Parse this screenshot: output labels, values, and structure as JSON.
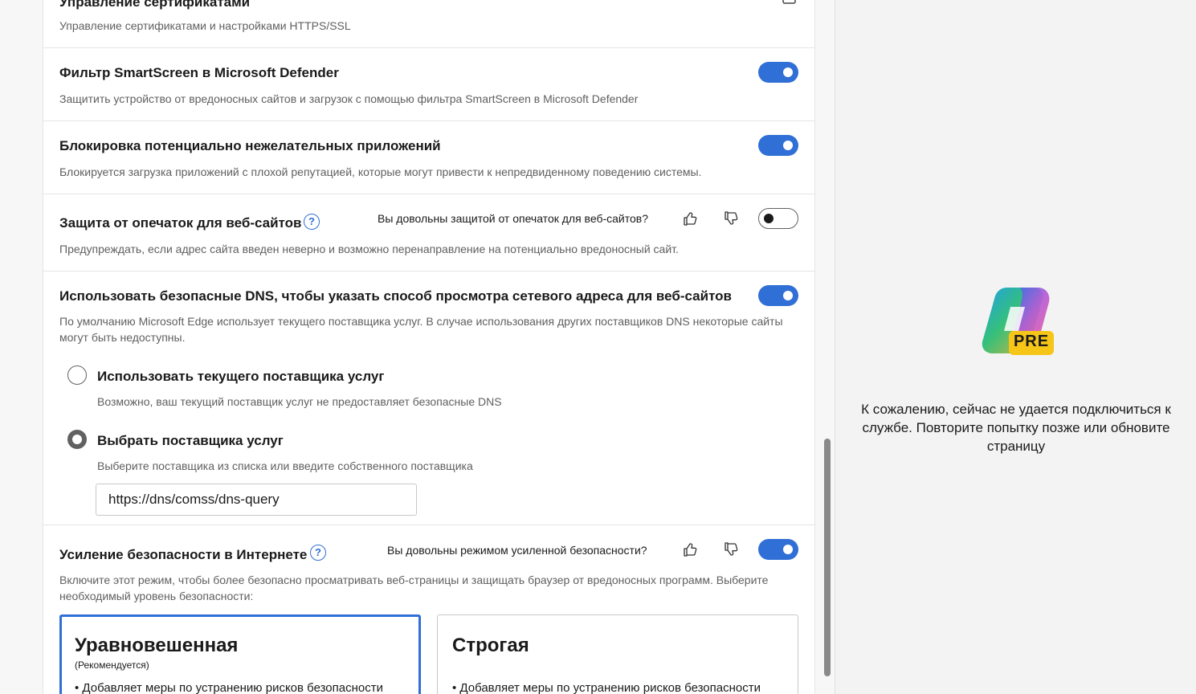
{
  "settings": {
    "certificates": {
      "title": "Управление сертификатами",
      "desc": "Управление сертификатами и настройками HTTPS/SSL"
    },
    "smartscreen": {
      "title": "Фильтр SmartScreen в Microsoft Defender",
      "desc": "Защитить устройство от вредоносных сайтов и загрузок с помощью фильтра SmartScreen в Microsoft Defender",
      "enabled": true
    },
    "pua": {
      "title": "Блокировка потенциально нежелательных приложений",
      "desc": "Блокируется загрузка приложений с плохой репутацией, которые могут привести к непредвиденному поведению системы.",
      "enabled": true
    },
    "typo": {
      "title": "Защита от опечаток для веб-сайтов",
      "help": "?",
      "feedback": "Вы довольны защитой от опечаток для веб-сайтов?",
      "desc": "Предупреждать, если адрес сайта введен неверно и возможно перенаправление на потенциально вредоносный сайт.",
      "enabled": false
    },
    "dns": {
      "title": "Использовать безопасные DNS, чтобы указать способ просмотра сетевого адреса для веб-сайтов",
      "desc": "По умолчанию Microsoft Edge использует текущего поставщика услуг. В случае использования других поставщиков DNS некоторые сайты могут быть недоступны.",
      "enabled": true,
      "option_current": {
        "label": "Использовать текущего поставщика услуг",
        "desc": "Возможно, ваш текущий поставщик услуг не предоставляет безопасные DNS",
        "checked": false
      },
      "option_custom": {
        "label": "Выбрать поставщика услуг",
        "desc": "Выберите поставщика из списка или введите собственного поставщика",
        "checked": true,
        "value": "https://dns/comss/dns-query"
      }
    },
    "enhanced": {
      "title": "Усиление безопасности в Интернете",
      "help": "?",
      "feedback": "Вы довольны режимом усиленной безопасности?",
      "desc": "Включите этот режим, чтобы более безопасно просматривать веб-страницы и защищать браузер от вредоносных программ. Выберите необходимый уровень безопасности:",
      "enabled": true,
      "levels": [
        {
          "title": "Уравновешенная",
          "sub": "(Рекомендуется)",
          "bullet": "•  Добавляет меры по устранению рисков безопасности",
          "selected": true
        },
        {
          "title": "Строгая",
          "sub": "",
          "bullet": "•  Добавляет меры по устранению рисков безопасности",
          "selected": false
        }
      ]
    }
  },
  "copilot": {
    "badge": "PRE",
    "message": "К сожалению, сейчас не удается подключиться к службе. Повторите попытку позже или обновите страницу"
  },
  "colors": {
    "accent": "#2f6fd6",
    "badge": "#f5c518"
  },
  "icons": [
    "help-icon",
    "thumbs-up-icon",
    "thumbs-down-icon",
    "copilot-logo-icon"
  ]
}
